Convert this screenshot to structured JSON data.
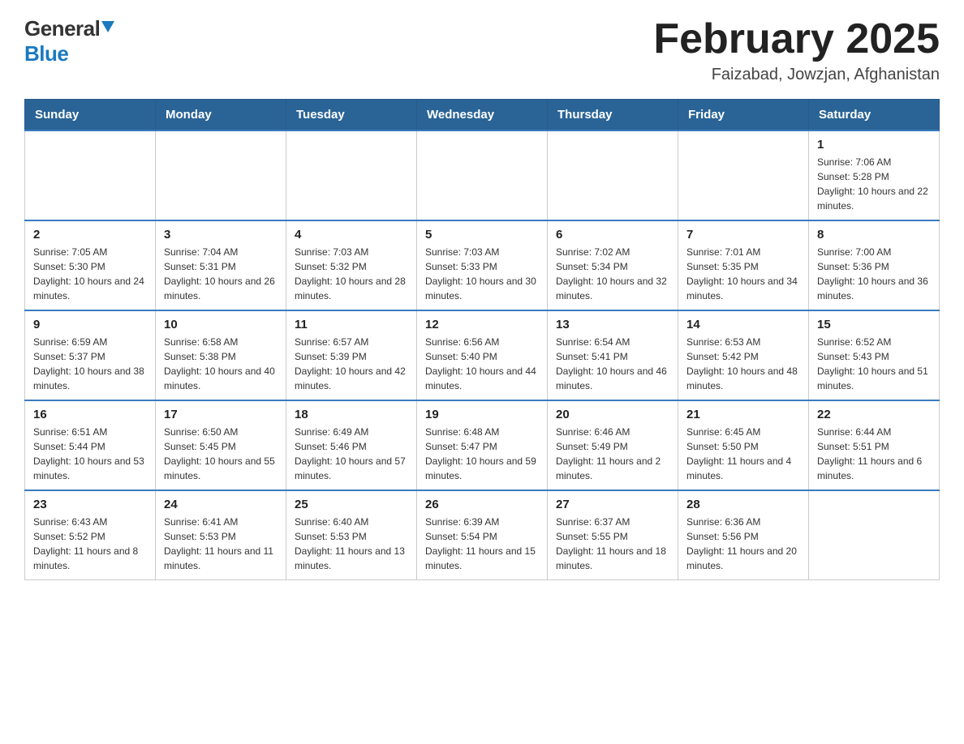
{
  "logo": {
    "general": "General",
    "blue": "Blue"
  },
  "title": "February 2025",
  "subtitle": "Faizabad, Jowzjan, Afghanistan",
  "days_of_week": [
    "Sunday",
    "Monday",
    "Tuesday",
    "Wednesday",
    "Thursday",
    "Friday",
    "Saturday"
  ],
  "weeks": [
    [
      {
        "day": "",
        "info": ""
      },
      {
        "day": "",
        "info": ""
      },
      {
        "day": "",
        "info": ""
      },
      {
        "day": "",
        "info": ""
      },
      {
        "day": "",
        "info": ""
      },
      {
        "day": "",
        "info": ""
      },
      {
        "day": "1",
        "info": "Sunrise: 7:06 AM\nSunset: 5:28 PM\nDaylight: 10 hours and 22 minutes."
      }
    ],
    [
      {
        "day": "2",
        "info": "Sunrise: 7:05 AM\nSunset: 5:30 PM\nDaylight: 10 hours and 24 minutes."
      },
      {
        "day": "3",
        "info": "Sunrise: 7:04 AM\nSunset: 5:31 PM\nDaylight: 10 hours and 26 minutes."
      },
      {
        "day": "4",
        "info": "Sunrise: 7:03 AM\nSunset: 5:32 PM\nDaylight: 10 hours and 28 minutes."
      },
      {
        "day": "5",
        "info": "Sunrise: 7:03 AM\nSunset: 5:33 PM\nDaylight: 10 hours and 30 minutes."
      },
      {
        "day": "6",
        "info": "Sunrise: 7:02 AM\nSunset: 5:34 PM\nDaylight: 10 hours and 32 minutes."
      },
      {
        "day": "7",
        "info": "Sunrise: 7:01 AM\nSunset: 5:35 PM\nDaylight: 10 hours and 34 minutes."
      },
      {
        "day": "8",
        "info": "Sunrise: 7:00 AM\nSunset: 5:36 PM\nDaylight: 10 hours and 36 minutes."
      }
    ],
    [
      {
        "day": "9",
        "info": "Sunrise: 6:59 AM\nSunset: 5:37 PM\nDaylight: 10 hours and 38 minutes."
      },
      {
        "day": "10",
        "info": "Sunrise: 6:58 AM\nSunset: 5:38 PM\nDaylight: 10 hours and 40 minutes."
      },
      {
        "day": "11",
        "info": "Sunrise: 6:57 AM\nSunset: 5:39 PM\nDaylight: 10 hours and 42 minutes."
      },
      {
        "day": "12",
        "info": "Sunrise: 6:56 AM\nSunset: 5:40 PM\nDaylight: 10 hours and 44 minutes."
      },
      {
        "day": "13",
        "info": "Sunrise: 6:54 AM\nSunset: 5:41 PM\nDaylight: 10 hours and 46 minutes."
      },
      {
        "day": "14",
        "info": "Sunrise: 6:53 AM\nSunset: 5:42 PM\nDaylight: 10 hours and 48 minutes."
      },
      {
        "day": "15",
        "info": "Sunrise: 6:52 AM\nSunset: 5:43 PM\nDaylight: 10 hours and 51 minutes."
      }
    ],
    [
      {
        "day": "16",
        "info": "Sunrise: 6:51 AM\nSunset: 5:44 PM\nDaylight: 10 hours and 53 minutes."
      },
      {
        "day": "17",
        "info": "Sunrise: 6:50 AM\nSunset: 5:45 PM\nDaylight: 10 hours and 55 minutes."
      },
      {
        "day": "18",
        "info": "Sunrise: 6:49 AM\nSunset: 5:46 PM\nDaylight: 10 hours and 57 minutes."
      },
      {
        "day": "19",
        "info": "Sunrise: 6:48 AM\nSunset: 5:47 PM\nDaylight: 10 hours and 59 minutes."
      },
      {
        "day": "20",
        "info": "Sunrise: 6:46 AM\nSunset: 5:49 PM\nDaylight: 11 hours and 2 minutes."
      },
      {
        "day": "21",
        "info": "Sunrise: 6:45 AM\nSunset: 5:50 PM\nDaylight: 11 hours and 4 minutes."
      },
      {
        "day": "22",
        "info": "Sunrise: 6:44 AM\nSunset: 5:51 PM\nDaylight: 11 hours and 6 minutes."
      }
    ],
    [
      {
        "day": "23",
        "info": "Sunrise: 6:43 AM\nSunset: 5:52 PM\nDaylight: 11 hours and 8 minutes."
      },
      {
        "day": "24",
        "info": "Sunrise: 6:41 AM\nSunset: 5:53 PM\nDaylight: 11 hours and 11 minutes."
      },
      {
        "day": "25",
        "info": "Sunrise: 6:40 AM\nSunset: 5:53 PM\nDaylight: 11 hours and 13 minutes."
      },
      {
        "day": "26",
        "info": "Sunrise: 6:39 AM\nSunset: 5:54 PM\nDaylight: 11 hours and 15 minutes."
      },
      {
        "day": "27",
        "info": "Sunrise: 6:37 AM\nSunset: 5:55 PM\nDaylight: 11 hours and 18 minutes."
      },
      {
        "day": "28",
        "info": "Sunrise: 6:36 AM\nSunset: 5:56 PM\nDaylight: 11 hours and 20 minutes."
      },
      {
        "day": "",
        "info": ""
      }
    ]
  ]
}
